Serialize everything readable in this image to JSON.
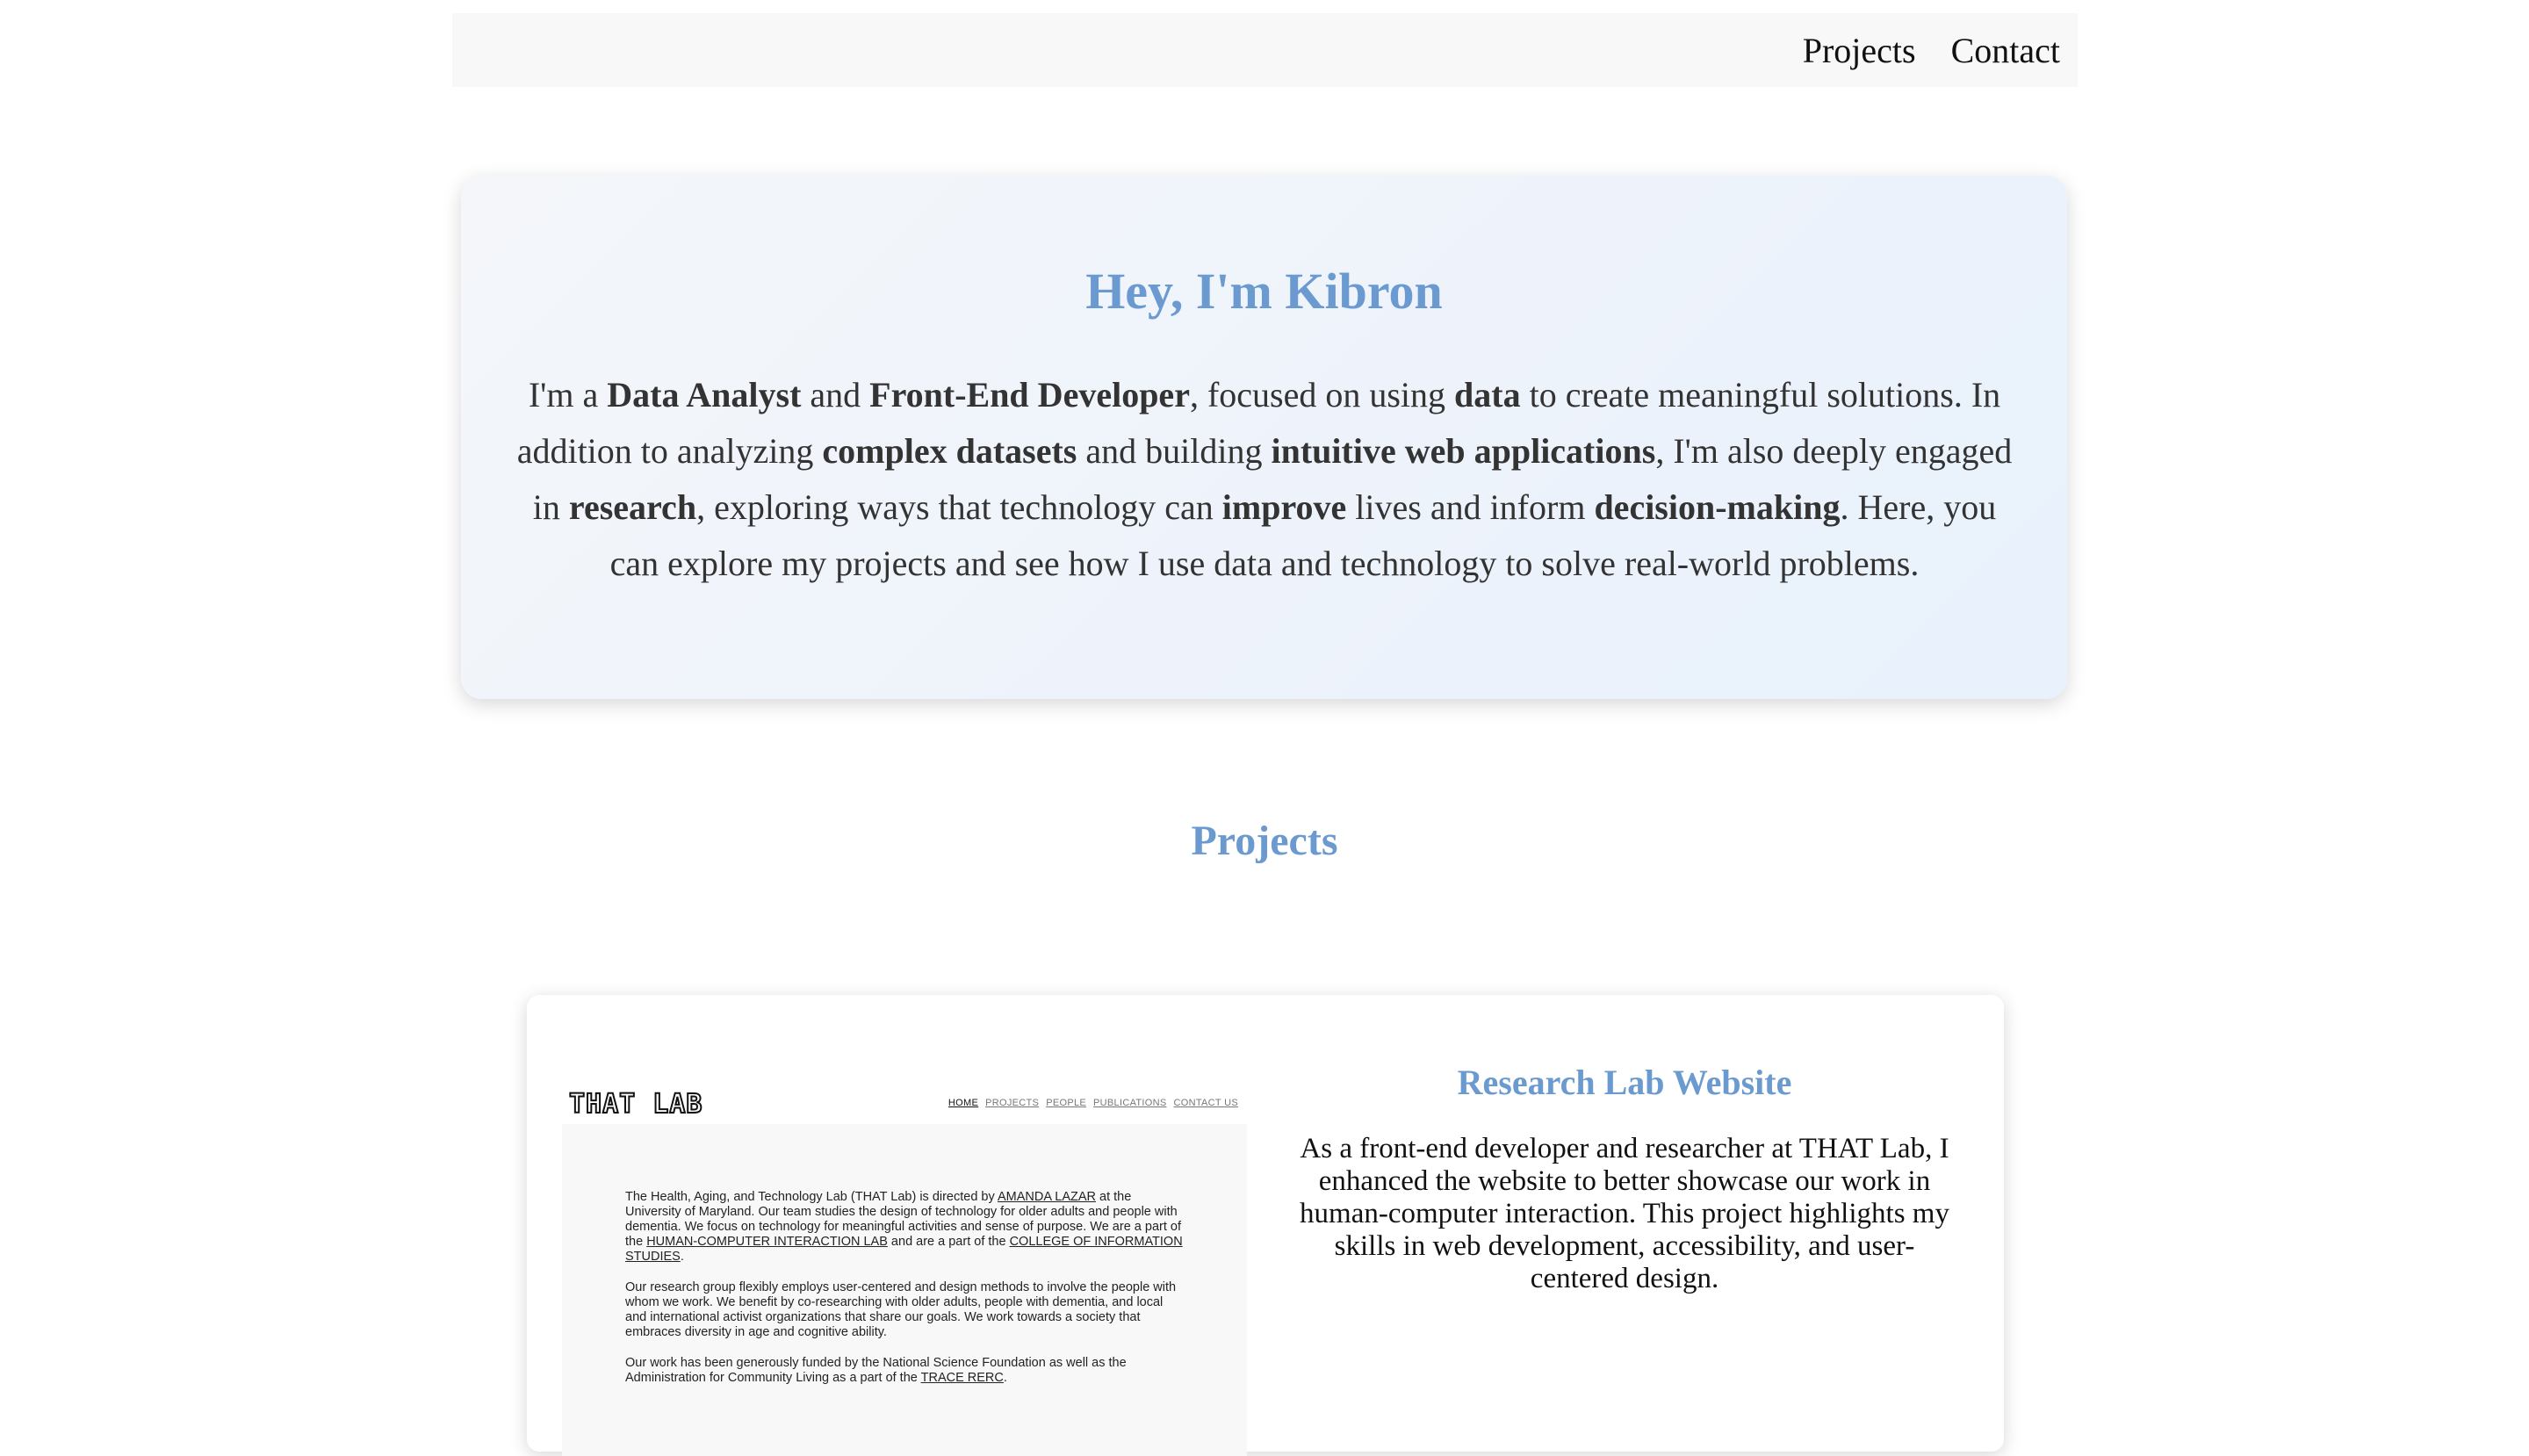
{
  "nav": {
    "links": [
      "Projects",
      "Contact"
    ]
  },
  "hero": {
    "title": "Hey, I'm Kibron",
    "text": [
      {
        "t": "I'm a ",
        "b": false
      },
      {
        "t": "Data Analyst",
        "b": true
      },
      {
        "t": " and ",
        "b": false
      },
      {
        "t": "Front-End Developer",
        "b": true
      },
      {
        "t": ", focused on using ",
        "b": false
      },
      {
        "t": "data",
        "b": true
      },
      {
        "t": " to create meaningful solutions. In addition to analyzing ",
        "b": false
      },
      {
        "t": "complex datasets",
        "b": true
      },
      {
        "t": " and building ",
        "b": false
      },
      {
        "t": "intuitive web applications",
        "b": true
      },
      {
        "t": ", I'm also deeply engaged in ",
        "b": false
      },
      {
        "t": "research",
        "b": true
      },
      {
        "t": ", exploring ways that technology can ",
        "b": false
      },
      {
        "t": "improve",
        "b": true
      },
      {
        "t": " lives and inform ",
        "b": false
      },
      {
        "t": "decision-making",
        "b": true
      },
      {
        "t": ". Here, you can explore my projects and see how I use data and technology to solve real-world problems.",
        "b": false
      }
    ]
  },
  "projects_section": {
    "title": "Projects"
  },
  "projects": [
    {
      "title": "Research Lab Website",
      "description": "As a front-end developer and researcher at THAT Lab, I enhanced the website to better showcase our work in human-computer interaction. This project highlights my skills in web development, accessibility, and user-centered design.",
      "screenshot": {
        "logo": "THAT LAB",
        "nav": [
          "HOME",
          "PROJECTS",
          "PEOPLE",
          "PUBLICATIONS",
          "CONTACT US"
        ],
        "paragraphs": [
          [
            {
              "t": "The Health, Aging, and Technology Lab (THAT Lab) is directed by ",
              "u": false
            },
            {
              "t": "AMANDA LAZAR",
              "u": true
            },
            {
              "t": " at the University of Maryland. Our team studies the design of technology for older adults and people with dementia. We focus on technology for meaningful activities and sense of purpose. We are a part of the ",
              "u": false
            },
            {
              "t": "HUMAN-COMPUTER INTERACTION LAB",
              "u": true
            },
            {
              "t": " and are a part of the ",
              "u": false
            },
            {
              "t": "COLLEGE OF INFORMATION STUDIES",
              "u": true
            },
            {
              "t": ".",
              "u": false
            }
          ],
          [
            {
              "t": "Our research group flexibly employs user-centered and design methods to involve the people with whom we work. We benefit by co-researching with older adults, people with dementia, and local and international activist organizations that share our goals. We work towards a society that embraces diversity in age and cognitive ability.",
              "u": false
            }
          ],
          [
            {
              "t": "Our work has been generously funded by the National Science Foundation as well as the Administration for Community Living as a part of the ",
              "u": false
            },
            {
              "t": "TRACE RERC",
              "u": true
            },
            {
              "t": ".",
              "u": false
            }
          ]
        ]
      }
    }
  ],
  "colors": {
    "accent": "#6b9ad0",
    "navbar_bg": "#f8f8f8",
    "text": "#333333"
  }
}
